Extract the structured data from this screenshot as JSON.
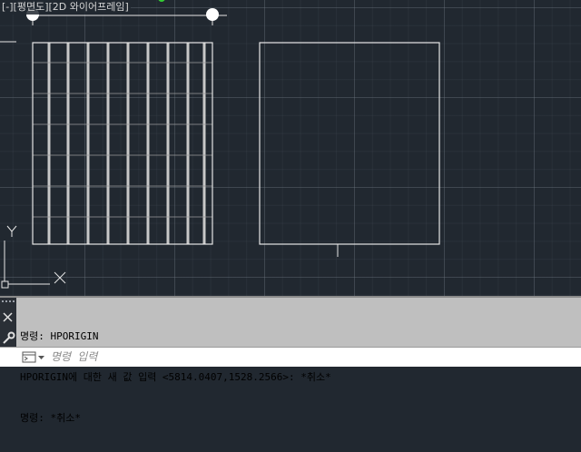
{
  "viewport": {
    "label": "[-][평면도][2D 와이어프레임]",
    "ucs": {
      "y_label": "Y",
      "x_label": "X"
    }
  },
  "command_history": [
    "명령: HPORIGIN",
    "HPORIGIN에 대한 새 값 입력 <5814.0407,1528.2566>: *취소*",
    "명령: *취소*"
  ],
  "command_input": {
    "placeholder": "명령 입력",
    "value": ""
  },
  "colors": {
    "background": "#212830",
    "geometry": "#e6e6e6",
    "command_panel": "#bfbfbf"
  },
  "icons": [
    "close-icon",
    "wrench-icon",
    "command-prompt-icon",
    "dropdown-arrow-icon",
    "grip-icon"
  ]
}
